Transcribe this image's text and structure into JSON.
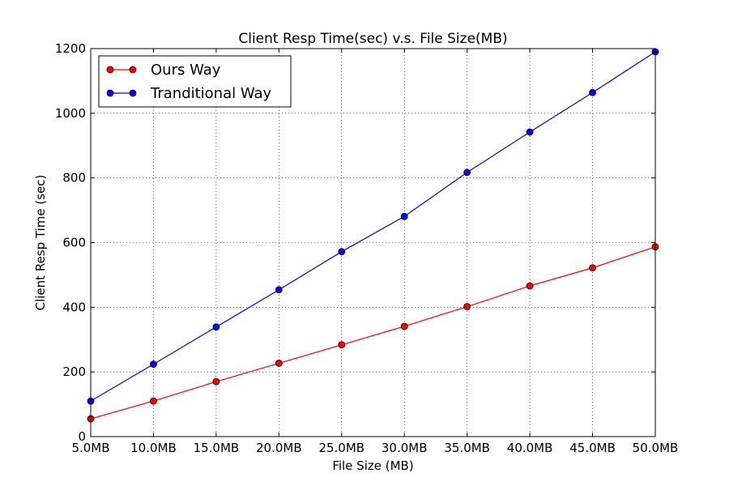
{
  "chart_data": {
    "type": "line",
    "title": "Client Resp Time(sec) v.s. File Size(MB)",
    "xlabel": "File Size (MB)",
    "ylabel": "Client Resp Time (sec)",
    "categories": [
      "5.0MB",
      "10.0MB",
      "15.0MB",
      "20.0MB",
      "25.0MB",
      "30.0MB",
      "35.0MB",
      "40.0MB",
      "45.0MB",
      "50.0MB"
    ],
    "ylim": [
      0,
      1200
    ],
    "yticks": [
      "0",
      "200",
      "400",
      "600",
      "800",
      "1000",
      "1200"
    ],
    "grid": true,
    "legend_position": "top-left",
    "series": [
      {
        "name": "Ours Way",
        "color": "#ff0000",
        "values": [
          55,
          110,
          170,
          227,
          284,
          341,
          402,
          466,
          522,
          587
        ]
      },
      {
        "name": "Tranditional Way",
        "color": "#0000ff",
        "values": [
          110,
          224,
          339,
          454,
          572,
          681,
          817,
          942,
          1064,
          1190
        ]
      }
    ]
  }
}
